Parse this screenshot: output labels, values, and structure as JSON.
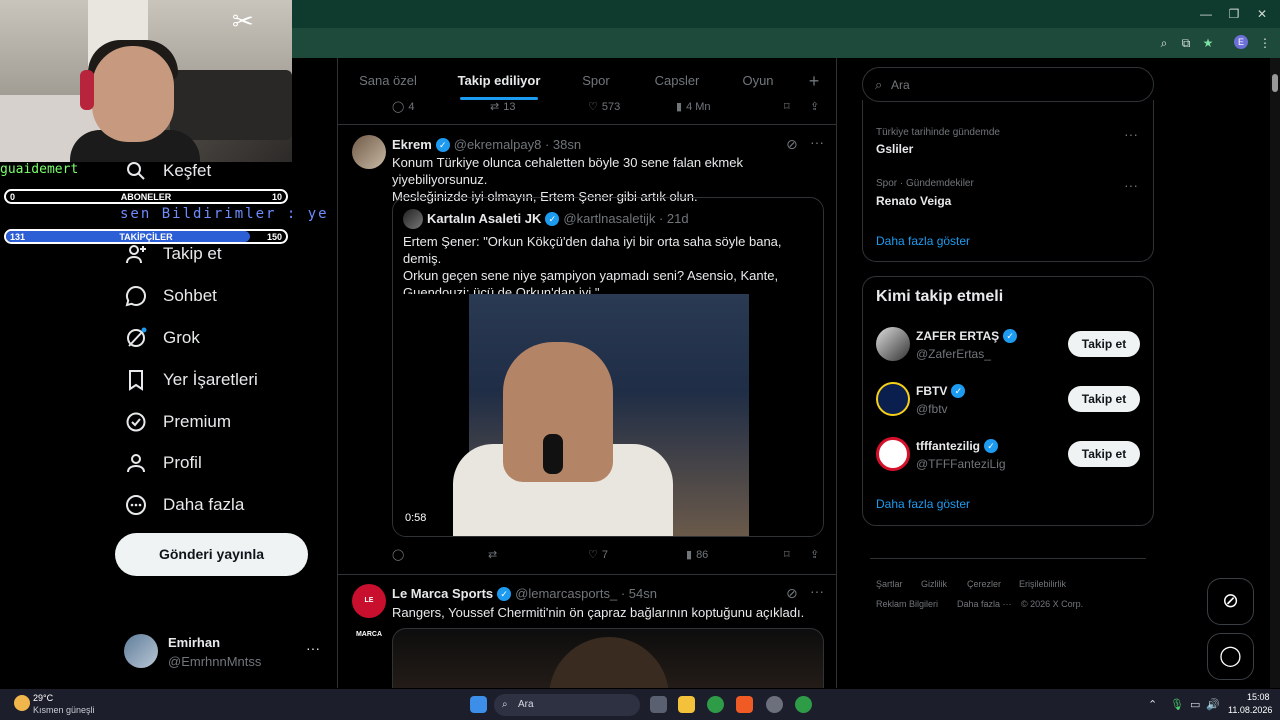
{
  "overlay": {
    "cam_name": "guaidemert",
    "subscribers": {
      "label": "ABONELER",
      "current": "0",
      "goal": "10",
      "fill": 0.0
    },
    "followers": {
      "label": "TAKİPÇİLER",
      "current": "131",
      "goal": "150",
      "fill": 0.87
    },
    "ghost_text": "sen Bildirimler :  ye"
  },
  "nav": {
    "items": [
      {
        "label": "Keşfet",
        "icon": "search-icon"
      },
      {
        "label": "Takip et",
        "icon": "add-user-icon"
      },
      {
        "label": "Sohbet",
        "icon": "chat-icon"
      },
      {
        "label": "Grok",
        "icon": "grok-icon"
      },
      {
        "label": "Yer İşaretleri",
        "icon": "bookmark-icon"
      },
      {
        "label": "Premium",
        "icon": "verified-icon"
      },
      {
        "label": "Profil",
        "icon": "person-icon"
      },
      {
        "label": "Daha fazla",
        "icon": "more-circle-icon"
      }
    ],
    "post_button": "Gönderi yayınla",
    "account": {
      "name": "Emirhan",
      "handle": "@EmrhnnMntss",
      "more": "···"
    }
  },
  "tabs": [
    {
      "label": "Sana özel",
      "active": false
    },
    {
      "label": "Takip ediliyor",
      "active": true
    },
    {
      "label": "Spor",
      "active": false
    },
    {
      "label": "Capsler",
      "active": false
    },
    {
      "label": "Oyun",
      "active": false
    },
    {
      "label": "+",
      "active": false
    }
  ],
  "prev_tweet_actions": {
    "replies": "4",
    "reposts": "13",
    "likes": "573",
    "views": "4 Mn"
  },
  "tweet1": {
    "name": "Ekrem",
    "handle_time": "@ekremalpay8 · 38sn",
    "text_line1": "Konum Türkiye olunca cehaletten böyle 30 sene falan ekmek yiyebiliyorsunuz.",
    "text_line2": "Mesleğinizde iyi olmayın, Ertem Şener gibi artık olun.",
    "quote": {
      "name": "Kartalın Asaleti JK",
      "handle_time": "@kartlnasaletijk · 21d",
      "line1": "Ertem Şener: \"Orkun Kökçü'den daha iyi bir orta saha söyle bana, demiş.",
      "line2": "Orkun geçen sene niye şampiyon yapmadı seni? Asensio, Kante,",
      "line3": "Guendouzi; üçü de Orkun'dan iyi.\"",
      "duration": "0:58"
    },
    "actions": {
      "replies": "",
      "reposts": "",
      "likes": "7",
      "views": "86"
    }
  },
  "tweet2": {
    "name": "Le Marca Sports",
    "handle_time": "@lemarcasports_ · 54sn",
    "avatar_text": "LE MARCA",
    "text": "Rangers, Youssef Chermiti'nin ön çapraz bağlarının koptuğunu açıkladı."
  },
  "right": {
    "search_placeholder": "Ara",
    "trends": [
      {
        "category": "Türkiye tarihinde gündemde",
        "name": "Gsliler"
      },
      {
        "category": "Spor · Gündemdekiler",
        "name": "Renato Veiga"
      }
    ],
    "show_more": "Daha fazla göster",
    "who_to_follow_title": "Kimi takip etmeli",
    "suggestions": [
      {
        "name": "ZAFER ERTAŞ",
        "handle": "@ZaferErtas_",
        "button": "Takip et"
      },
      {
        "name": "FBTV",
        "handle": "@fbtv",
        "button": "Takip et"
      },
      {
        "name": "tfffantezilig",
        "handle": "@TFFFanteziLig",
        "button": "Takip et"
      }
    ],
    "footer": [
      "Şartlar",
      "Gizlilik",
      "Çerezler",
      "Erişilebilirlik",
      "Reklam Bilgileri",
      "Daha fazla ···",
      "© 2026 X Corp."
    ]
  },
  "taskbar": {
    "temp": "29°C",
    "weather": "Kısmen güneşli",
    "search": "Ara",
    "time": "15:08",
    "date": "11.08.2026"
  },
  "colors": {
    "accent": "#1d9bf0",
    "chrome": "#0f3b2e",
    "background": "#000000"
  }
}
